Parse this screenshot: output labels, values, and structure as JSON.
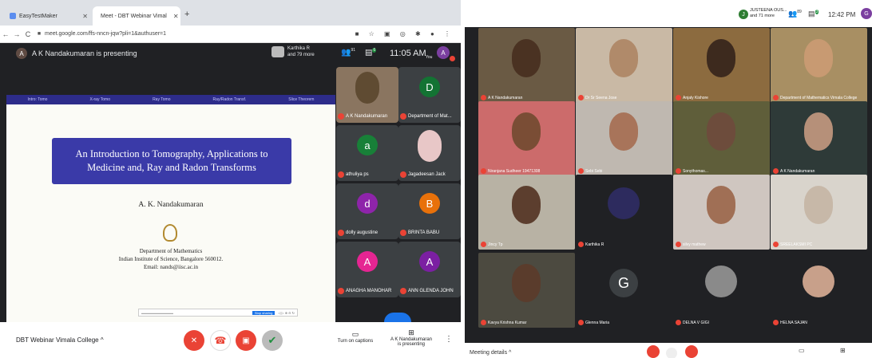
{
  "left_screen": {
    "browser": {
      "tabs": [
        {
          "label": "EasyTestMaker",
          "active": false
        },
        {
          "label": "Meet - DBT Webinar Vimal",
          "active": true
        }
      ],
      "new_tab": "+",
      "url": "meet.google.com/ffs-nncn-jqw?pli=1&authuser=1"
    },
    "meet": {
      "presenter_initial": "A",
      "presenting_text": "A K Nandakumaran is presenting",
      "participants_top": {
        "name": "Karthika R",
        "more": "and 79 more"
      },
      "people_count": "91",
      "chat_count": "6",
      "time": "11:05 AM",
      "self_label": "You",
      "self_initial": "A"
    },
    "slide": {
      "header_items": [
        "Intro: Tomo",
        "X-ray Tomo",
        "Ray Tomo",
        "Ray/Radon Transf.",
        "Slice Theorem"
      ],
      "title": "An Introduction to Tomography, Applications to Medicine and, Ray and Radon Transforms",
      "author": "A. K. Nandakumaran",
      "department": "Department of Mathematics",
      "institute": "Indian Institute of Science, Bangalore 560012.",
      "email": "Email: nands@iisc.ac.in",
      "toolbar_button": "Stop sharing"
    },
    "participants": [
      {
        "name": "A K Nandakumaran",
        "initial": "",
        "color": "#5f4b32",
        "video": true
      },
      {
        "name": "Department of Mat...",
        "initial": "D",
        "color": "#137333"
      },
      {
        "name": "athuliya ps",
        "initial": "a",
        "color": "#188038"
      },
      {
        "name": "Jagadeesan Jack",
        "initial": "",
        "color": "#e8c7c7",
        "video": true
      },
      {
        "name": "dolly augustine",
        "initial": "d",
        "color": "#8e24aa"
      },
      {
        "name": "BRINTA BABU",
        "initial": "B",
        "color": "#e8710a"
      },
      {
        "name": "ANAGHA MANOHAR",
        "initial": "A",
        "color": "#e52592"
      },
      {
        "name": "ANN GLENDA JOHN",
        "initial": "A",
        "color": "#7b1fa2"
      }
    ],
    "bottom": {
      "meeting_name": "DBT Webinar Vimala College",
      "captions_label": "Turn on captions",
      "presenting_label_1": "A K Nandakumaran",
      "presenting_label_2": "is presenting"
    }
  },
  "right_screen": {
    "top": {
      "participant_initial": "J",
      "participant_name": "JUSTEENA OUS...",
      "more": "and 71 more",
      "people_count": "89",
      "chat_count": "3",
      "time": "12:42 PM",
      "self_initial": "G"
    },
    "tiles": [
      {
        "name": "A K Nandakumaran",
        "bg": "#6a5a44",
        "face": "#4a3222"
      },
      {
        "name": "Dr Sr Seena Jose",
        "bg": "#c9b9a5",
        "face": "#b08a6a"
      },
      {
        "name": "Anjaly Kishore",
        "bg": "#8c6b3f",
        "face": "#3d2a1e"
      },
      {
        "name": "Department of Mathematics Vimala College",
        "bg": "#a88f63",
        "face": "#c89a72"
      },
      {
        "name": "Niranjana Sudheer 19471308",
        "bg": "#cc6b6b",
        "face": "#7a4d35"
      },
      {
        "name": "Sebi Sebi",
        "bg": "#bfb8b0",
        "face": "#a8745a"
      },
      {
        "name": "Sonythomas...",
        "bg": "#5f5e3a",
        "face": "#6d4c3c"
      },
      {
        "name": "A K Nandakumaran",
        "bg": "#2e3a38",
        "face": "#b69079"
      },
      {
        "name": "Jincy Tp",
        "bg": "#b8b2a4",
        "face": "#5c3e2e"
      },
      {
        "name": "Karthika R",
        "bg": "#202124",
        "face": "#2d2b5e",
        "avatar_art": true
      },
      {
        "name": "silvy mathew",
        "bg": "#cfc6c0",
        "face": "#a06f55"
      },
      {
        "name": "SREELAKSMI PC",
        "bg": "#d9d4cc",
        "face": "#c7b8a8"
      },
      {
        "name": "Kavya Krishna Kumar",
        "bg": "#4c4a40",
        "face": "#5a3c2c"
      },
      {
        "name": "Glenna Maria",
        "bg": "#202124",
        "initial": "G",
        "initial_color": "#3c4043"
      },
      {
        "name": "DELNA V GIGI",
        "bg": "#202124",
        "face": "#8a8a8a",
        "avatar_art": true
      },
      {
        "name": "HELNA SAJAN",
        "bg": "#202124",
        "face": "#c8a08a",
        "avatar_art": true
      }
    ],
    "bottom": {
      "meeting_details": "Meeting details"
    }
  }
}
